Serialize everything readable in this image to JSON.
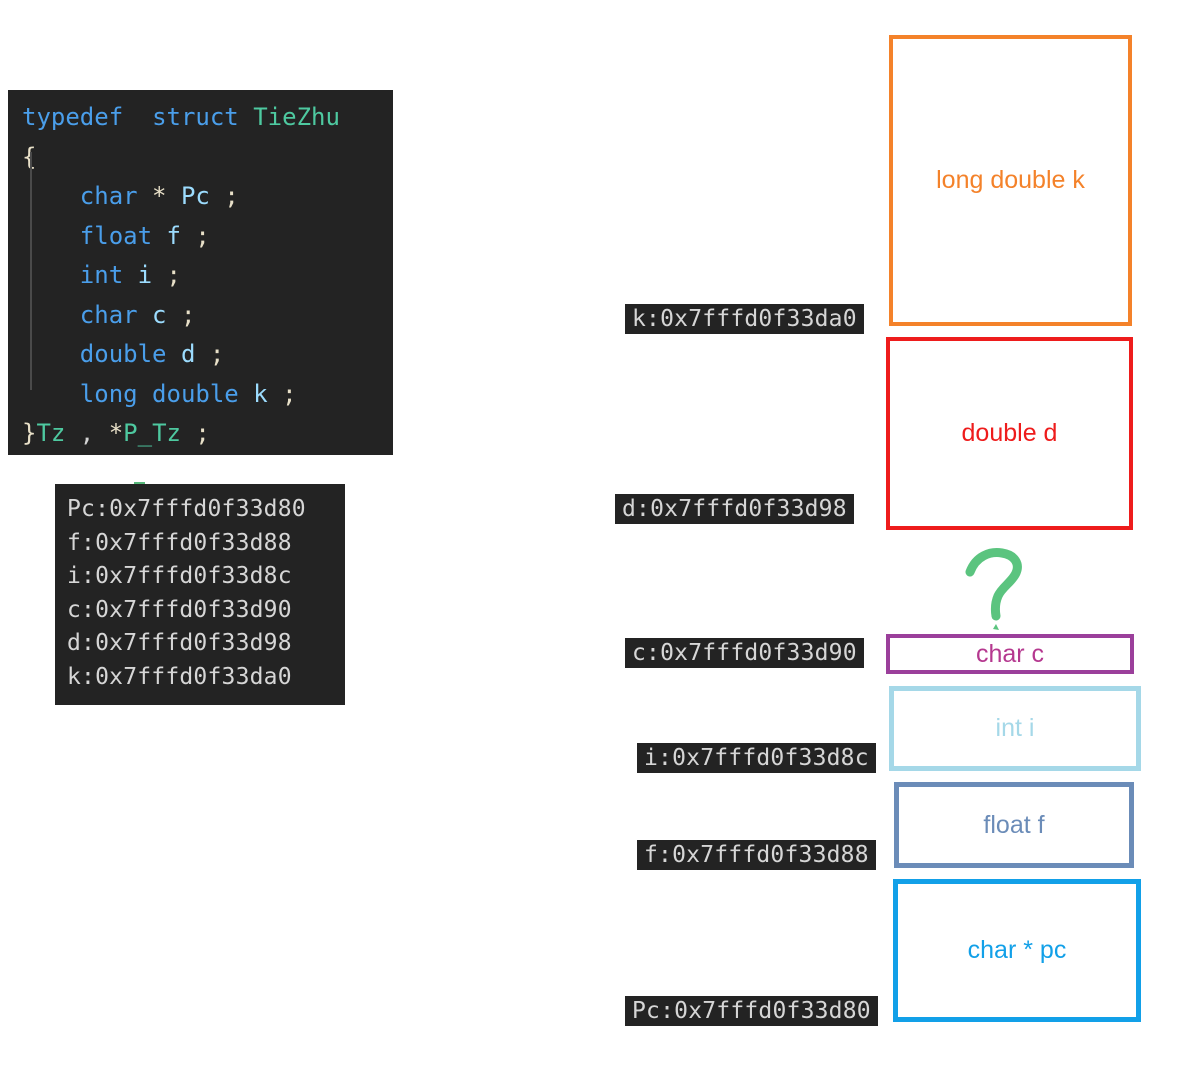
{
  "code_block": {
    "language": "c",
    "background": "#232323",
    "lines": [
      [
        {
          "t": "typedef",
          "c": "kw"
        },
        {
          "t": "  ",
          "c": "punct"
        },
        {
          "t": "struct",
          "c": "kw"
        },
        {
          "t": " ",
          "c": "punct"
        },
        {
          "t": "TieZhu",
          "c": "tname"
        }
      ],
      [
        {
          "t": "{",
          "c": "brace"
        }
      ],
      [
        {
          "t": "    ",
          "c": "punct"
        },
        {
          "t": "char",
          "c": "type"
        },
        {
          "t": " ",
          "c": "punct"
        },
        {
          "t": "*",
          "c": "star"
        },
        {
          "t": " ",
          "c": "punct"
        },
        {
          "t": "Pc",
          "c": "ident"
        },
        {
          "t": " ",
          "c": "punct"
        },
        {
          "t": ";",
          "c": "star"
        }
      ],
      [
        {
          "t": "    ",
          "c": "punct"
        },
        {
          "t": "float",
          "c": "type"
        },
        {
          "t": " ",
          "c": "punct"
        },
        {
          "t": "f",
          "c": "ident"
        },
        {
          "t": " ",
          "c": "punct"
        },
        {
          "t": ";",
          "c": "star"
        }
      ],
      [
        {
          "t": "    ",
          "c": "punct"
        },
        {
          "t": "int",
          "c": "type"
        },
        {
          "t": " ",
          "c": "punct"
        },
        {
          "t": "i",
          "c": "ident"
        },
        {
          "t": " ",
          "c": "punct"
        },
        {
          "t": ";",
          "c": "star"
        }
      ],
      [
        {
          "t": "    ",
          "c": "punct"
        },
        {
          "t": "char",
          "c": "type"
        },
        {
          "t": " ",
          "c": "punct"
        },
        {
          "t": "c",
          "c": "ident"
        },
        {
          "t": " ",
          "c": "punct"
        },
        {
          "t": ";",
          "c": "star"
        }
      ],
      [
        {
          "t": "    ",
          "c": "punct"
        },
        {
          "t": "double",
          "c": "type"
        },
        {
          "t": " ",
          "c": "punct"
        },
        {
          "t": "d",
          "c": "ident"
        },
        {
          "t": " ",
          "c": "punct"
        },
        {
          "t": ";",
          "c": "star"
        }
      ],
      [
        {
          "t": "    ",
          "c": "punct"
        },
        {
          "t": "long",
          "c": "type"
        },
        {
          "t": " ",
          "c": "punct"
        },
        {
          "t": "double",
          "c": "type"
        },
        {
          "t": " ",
          "c": "punct"
        },
        {
          "t": "k",
          "c": "ident"
        },
        {
          "t": " ",
          "c": "punct"
        },
        {
          "t": ";",
          "c": "star"
        }
      ],
      [
        {
          "t": "}",
          "c": "brace"
        },
        {
          "t": "Tz",
          "c": "tname"
        },
        {
          "t": " , ",
          "c": "punct"
        },
        {
          "t": "*",
          "c": "star"
        },
        {
          "t": "P_Tz",
          "c": "tname"
        },
        {
          "t": " ",
          "c": "punct"
        },
        {
          "t": ";",
          "c": "star"
        }
      ]
    ]
  },
  "address_list": {
    "background": "#232323",
    "lines": [
      "Pc:0x7fffd0f33d80",
      "f:0x7fffd0f33d88",
      "i:0x7fffd0f33d8c",
      "c:0x7fffd0f33d90",
      "d:0x7fffd0f33d98",
      "k:0x7fffd0f33da0"
    ]
  },
  "memory_layout": {
    "annotation_icon": "green-question-mark",
    "boxes": [
      {
        "id": "k",
        "label": "long double k",
        "color": "#f4822a",
        "address_chip": "k:0x7fffd0f33da0"
      },
      {
        "id": "d",
        "label": "double d",
        "color": "#ee1c1c",
        "address_chip": "d:0x7fffd0f33d98"
      },
      {
        "id": "c",
        "label": "char c",
        "color": "#9b3f9b",
        "address_chip": "c:0x7fffd0f33d90"
      },
      {
        "id": "i",
        "label": "int i",
        "color": "#a5d8e8",
        "address_chip": "i:0x7fffd0f33d8c"
      },
      {
        "id": "f",
        "label": "float f",
        "color": "#6b8cb8",
        "address_chip": "f:0x7fffd0f33d88"
      },
      {
        "id": "pc",
        "label": "char * pc",
        "color": "#12a0e8",
        "address_chip": "Pc:0x7fffd0f33d80"
      }
    ]
  }
}
